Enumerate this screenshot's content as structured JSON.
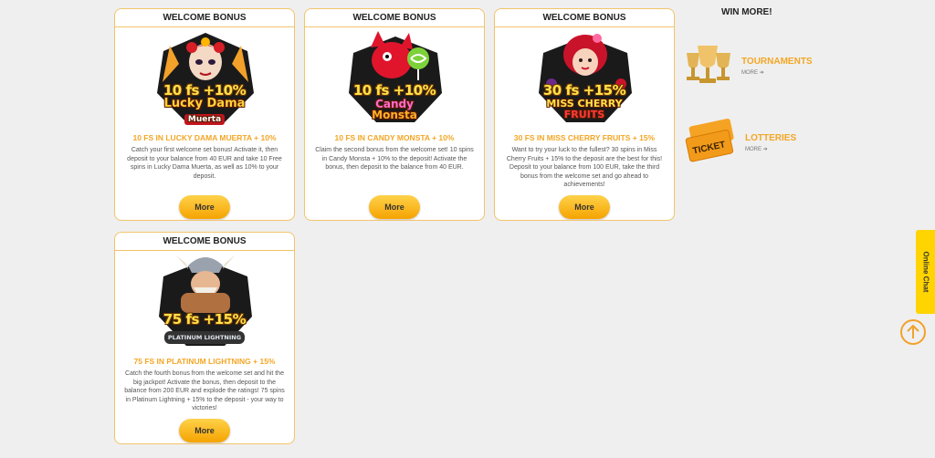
{
  "cards": [
    {
      "header": "WELCOME BONUS",
      "logo_fs": "10 fs +10%",
      "logo_name": "Lucky Dama",
      "logo_sub": "Muerta",
      "title": "10 FS IN LUCKY DAMA MUERTA + 10%",
      "description": "Catch your first welcome set bonus! Activate it, then deposit to your balance from 40 EUR and take 10 Free spins in Lucky Dama Muerta, as well as 10% to your deposit.",
      "button": "More"
    },
    {
      "header": "WELCOME BONUS",
      "logo_fs": "10 fs +10%",
      "logo_name": "Candy",
      "logo_sub": "Monsta",
      "title": "10 FS IN CANDY MONSTA + 10%",
      "description": "Claim the second bonus from the welcome set! 10 spins in Candy Monsta + 10% to the deposit! Activate the bonus, then deposit to the balance from 40 EUR.",
      "button": "More"
    },
    {
      "header": "WELCOME BONUS",
      "logo_fs": "30 fs +15%",
      "logo_name": "MISS CHERRY",
      "logo_sub": "FRUITS",
      "title": "30 FS IN MISS CHERRY FRUITS + 15%",
      "description": "Want to try your luck to the fullest? 30 spins in Miss Cherry Fruits + 15% to the deposit are the best for this! Deposit to your balance from 100 EUR, take the third bonus from the welcome set and go ahead to achievements!",
      "button": "More"
    },
    {
      "header": "WELCOME BONUS",
      "logo_fs": "75 fs +15%",
      "logo_name": "PLATINUM LIGHTNING",
      "logo_sub": "",
      "title": "75 FS IN PLATINUM LIGHTNING + 15%",
      "description": "Catch the fourth bonus from the welcome set and hit the big jackpot! Activate the bonus, then deposit to the balance from 200 EUR and explode the ratings! 75 spins in Platinum Lightning + 15% to the deposit - your way to victories!",
      "button": "More"
    }
  ],
  "sidebar": {
    "title": "WIN MORE!",
    "links": [
      {
        "label": "TOURNAMENTS",
        "more": "MORE",
        "icon": "trophies-icon"
      },
      {
        "label": "LOTTERIES",
        "more": "MORE",
        "icon": "ticket-icon",
        "ticket_text": "TICKET"
      }
    ]
  },
  "chat": {
    "label": "Online Chat"
  },
  "colors": {
    "accent": "#f3a624",
    "button": "#ffc52a",
    "chat": "#ffd400"
  }
}
